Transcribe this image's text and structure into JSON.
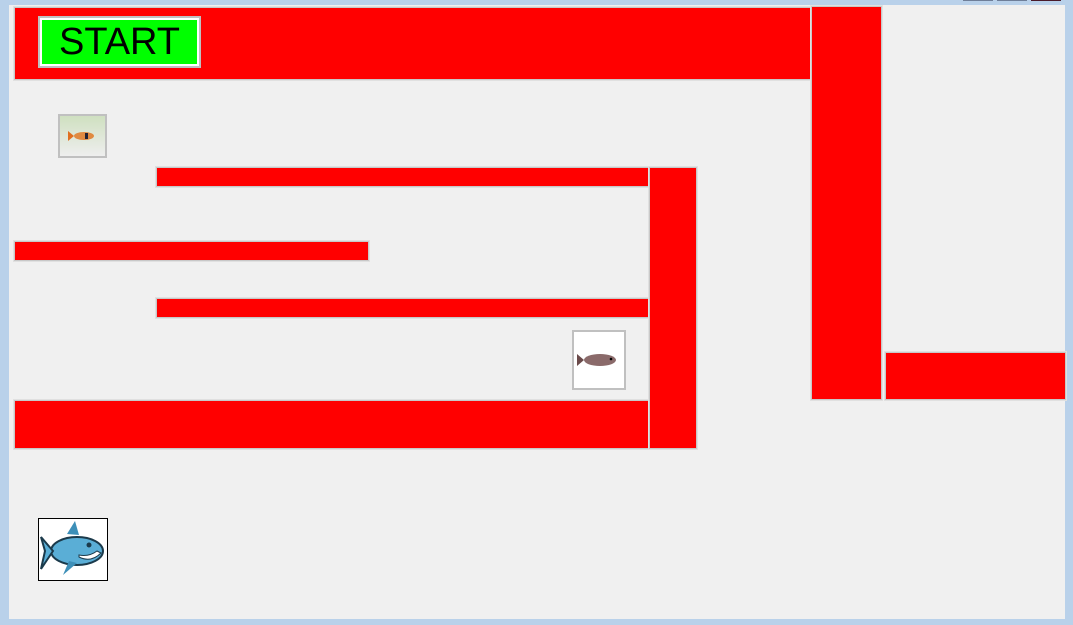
{
  "start_button": {
    "label": "START"
  },
  "colors": {
    "wall": "#ff0000",
    "start": "#00ff00",
    "background": "#f0f0f0"
  },
  "sprites": {
    "player": "shark-icon",
    "fish_small": "fish-icon",
    "fish_large": "fish-icon"
  }
}
